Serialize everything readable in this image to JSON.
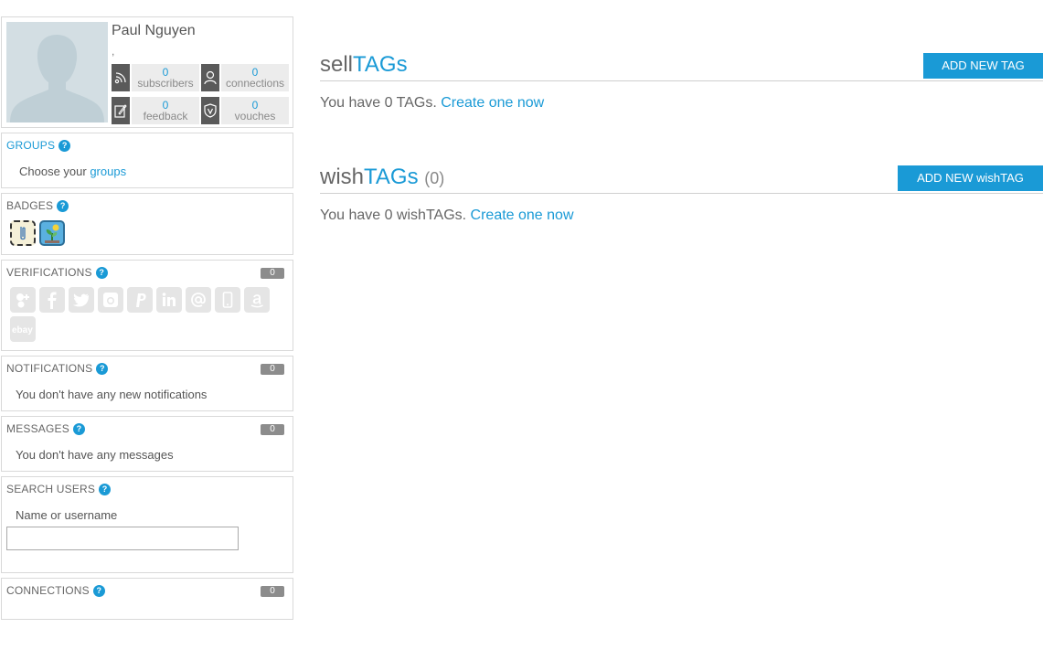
{
  "profile": {
    "name": "Paul Nguyen",
    "location": ",",
    "stats": [
      {
        "icon": "rss-icon",
        "value": "0",
        "label": "subscribers"
      },
      {
        "icon": "person-icon",
        "value": "0",
        "label": "connections"
      },
      {
        "icon": "edit-icon",
        "value": "0",
        "label": "feedback"
      },
      {
        "icon": "shield-v-icon",
        "value": "0",
        "label": "vouches"
      }
    ]
  },
  "groups": {
    "title": "GROUPS",
    "help": "?",
    "text": "Choose your ",
    "link": "groups"
  },
  "badges": {
    "title": "BADGES",
    "help": "?",
    "items": [
      "clip-badge-icon",
      "plant-badge-icon"
    ]
  },
  "verifications": {
    "title": "VERIFICATIONS",
    "help": "?",
    "count": "0",
    "icons": [
      "google-plus-icon",
      "facebook-icon",
      "twitter-icon",
      "instagram-icon",
      "paypal-icon",
      "linkedin-icon",
      "email-icon",
      "phone-icon",
      "amazon-icon",
      "ebay-icon"
    ]
  },
  "notifications": {
    "title": "NOTIFICATIONS",
    "help": "?",
    "count": "0",
    "text": "You don't have any new notifications"
  },
  "messages": {
    "title": "MESSAGES",
    "help": "?",
    "count": "0",
    "text": "You don't have any messages"
  },
  "search": {
    "title": "SEARCH USERS",
    "help": "?",
    "label": "Name or username",
    "value": ""
  },
  "connections": {
    "title": "CONNECTIONS",
    "help": "?",
    "count": "0"
  },
  "sell": {
    "title_a": "sell",
    "title_b": "TAGs",
    "button": "ADD NEW TAG",
    "text": "You have 0 TAGs. ",
    "link": "Create one now"
  },
  "wish": {
    "title_a": "wish",
    "title_b": "TAGs",
    "count": "(0)",
    "button": "ADD NEW wishTAG",
    "text": "You have 0 wishTAGs. ",
    "link": "Create one now"
  },
  "colors": {
    "accent": "#1a9ad6",
    "pill": "#8c8c8c",
    "icon_bg": "#5a5a5a"
  }
}
